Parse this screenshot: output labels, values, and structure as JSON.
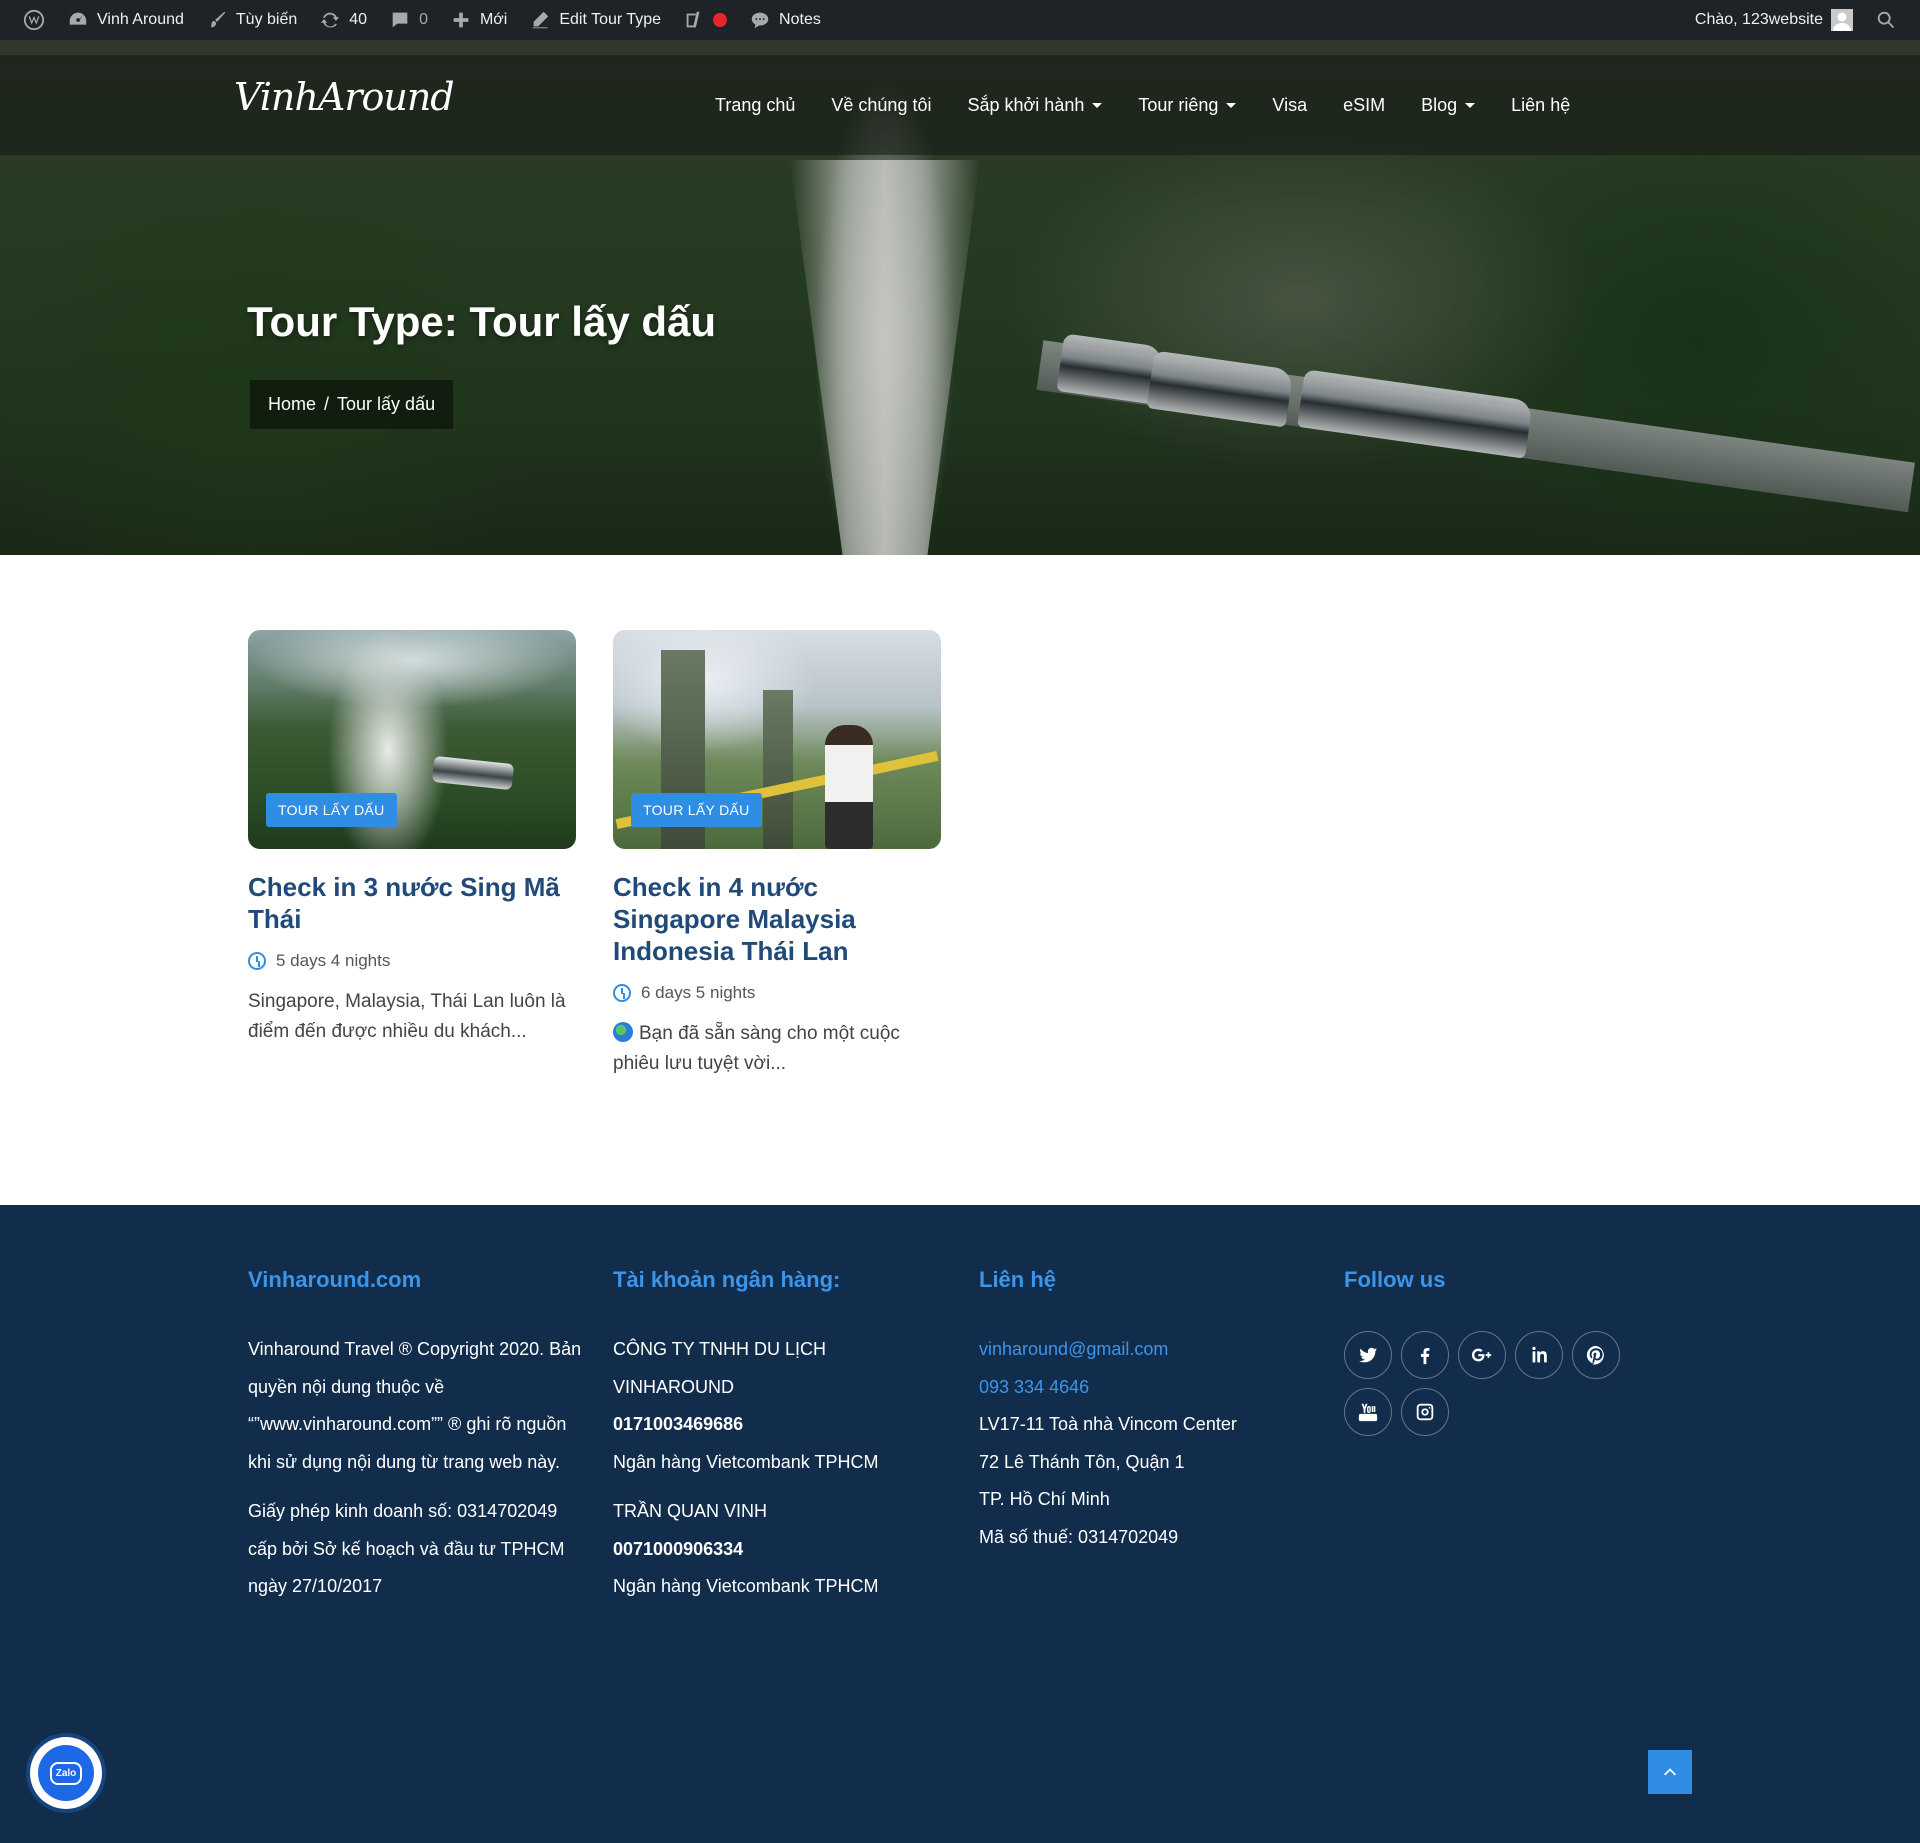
{
  "admin_bar": {
    "site_name": "Vinh Around",
    "customize": "Tùy biến",
    "updates_count": "40",
    "comments_count": "0",
    "new": "Mới",
    "edit": "Edit Tour Type",
    "notes": "Notes",
    "greeting": "Chào, 123website"
  },
  "header": {
    "logo": "VinhAround",
    "menu": [
      {
        "label": "Trang chủ",
        "dropdown": false
      },
      {
        "label": "Về chúng tôi",
        "dropdown": false
      },
      {
        "label": "Sắp khởi hành",
        "dropdown": true
      },
      {
        "label": "Tour riêng",
        "dropdown": true
      },
      {
        "label": "Visa",
        "dropdown": false
      },
      {
        "label": "eSIM",
        "dropdown": false
      },
      {
        "label": "Blog",
        "dropdown": true
      },
      {
        "label": "Liên hệ",
        "dropdown": false
      }
    ]
  },
  "hero": {
    "title": "Tour Type: Tour lấy dấu",
    "breadcrumb": {
      "home": "Home",
      "separator": "/",
      "current": "Tour lấy dấu"
    }
  },
  "tours": [
    {
      "badge": "Tour lấy dấu",
      "title": "Check in 3 nước Sing Mã Thái",
      "duration": "5 days 4 nights",
      "excerpt": "Singapore, Malaysia, Thái Lan luôn là điểm đến được nhiều du khách..."
    },
    {
      "badge": "Tour lấy dấu",
      "title": "Check in 4 nước Singapore Malaysia Indonesia Thái Lan",
      "duration": "6 days 5 nights",
      "excerpt": "Bạn đã sẵn sàng cho một cuộc phiêu lưu tuyệt vời..."
    }
  ],
  "footer": {
    "col1": {
      "heading": "Vinharound.com",
      "p1": "Vinharound Travel ® Copyright 2020. Bản quyền nội dung thuộc về “”www.vinharound.com”” ® ghi rõ nguồn khi sử dụng nội dung từ trang web này.",
      "p2": "Giấy phép kinh doanh số: 0314702049 cấp bởi Sở kế hoạch và đầu tư TPHCM ngày 27/10/2017"
    },
    "col2": {
      "heading": "Tài khoản ngân hàng:",
      "company": "CÔNG TY TNHH DU LỊCH VINHAROUND",
      "account1": "0171003469686",
      "bank1": "Ngân hàng Vietcombank TPHCM",
      "name2": "TRẦN QUAN VINH",
      "account2": "0071000906334",
      "bank2": "Ngân hàng Vietcombank TPHCM"
    },
    "col3": {
      "heading": "Liên hệ",
      "email": "vinharound@gmail.com",
      "phone": "093 334 4646",
      "address1": "LV17-11 Toà nhà Vincom Center",
      "address2": "72 Lê Thánh Tôn, Quận 1",
      "city": "TP. Hồ Chí Minh",
      "tax": "Mã số thuế: 0314702049"
    },
    "col4": {
      "heading": "Follow us",
      "socials": [
        "twitter-icon",
        "facebook-icon",
        "google-plus-icon",
        "linkedin-icon",
        "pinterest-icon",
        "youtube-icon",
        "instagram-icon"
      ]
    }
  },
  "widgets": {
    "zalo": "Zalo"
  },
  "colors": {
    "accent": "#2f8ee3",
    "title_blue": "#214a78",
    "footer_bg": "#122d4b",
    "admin_bar_bg": "#1d2327"
  }
}
